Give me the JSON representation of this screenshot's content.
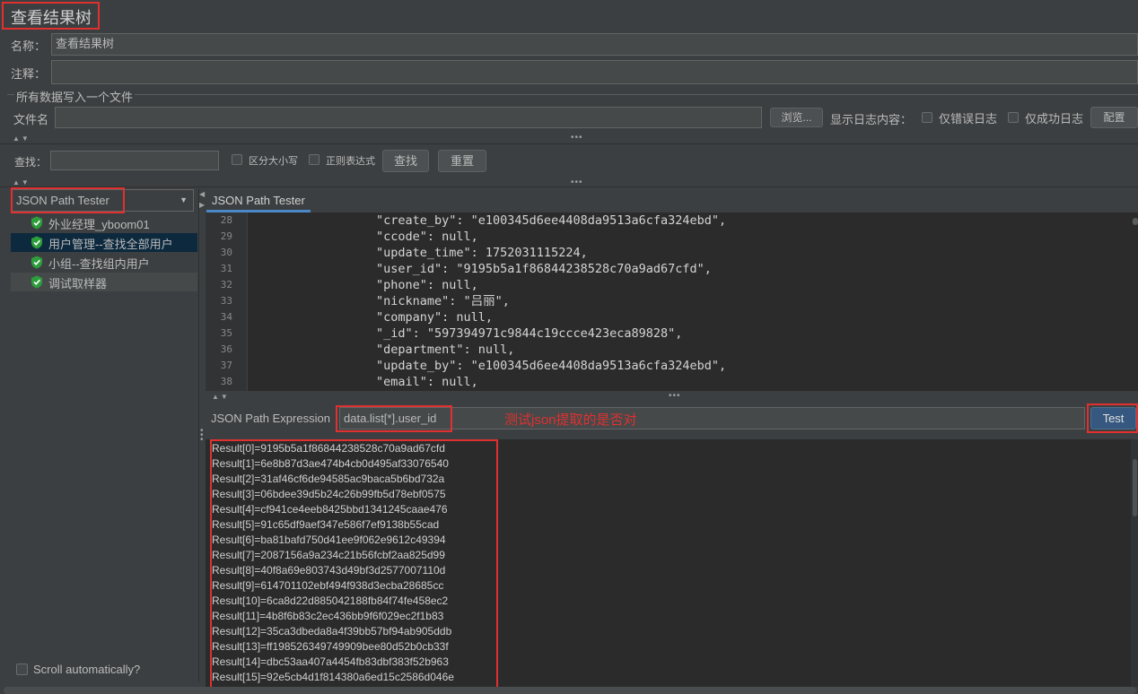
{
  "title": "查看结果树",
  "name_label": "名称：",
  "name_value": "查看结果树",
  "comment_label": "注释：",
  "comment_value": "",
  "group_title": "所有数据写入一个文件",
  "filename_label": "文件名",
  "filename_value": "",
  "browse_button": "浏览...",
  "log_content_label": "显示日志内容：",
  "errors_only_label": "仅错误日志",
  "success_only_label": "仅成功日志",
  "config_button": "配置",
  "search": {
    "label": "查找：",
    "value": "",
    "case_sensitive_label": "区分大小写",
    "regex_label": "正则表达式",
    "find_button": "查找",
    "reset_button": "重置"
  },
  "renderer_select": "JSON Path Tester",
  "tree_items": [
    {
      "label": "外业经理_yboom01",
      "status": "success"
    },
    {
      "label": "用户管理--查找全部用户",
      "status": "success"
    },
    {
      "label": "小组--查找组内用户",
      "status": "success"
    },
    {
      "label": "调试取样器",
      "status": "success"
    }
  ],
  "scroll_auto_label": "Scroll automatically?",
  "tab_label": "JSON Path Tester",
  "code_lines": [
    {
      "n": "28",
      "text": "\"create_by\": \"e100345d6ee4408da9513a6cfa324ebd\","
    },
    {
      "n": "29",
      "text": "\"ccode\": null,"
    },
    {
      "n": "30",
      "text": "\"update_time\": 1752031115224,"
    },
    {
      "n": "31",
      "text": "\"user_id\": \"9195b5a1f86844238528c70a9ad67cfd\","
    },
    {
      "n": "32",
      "text": "\"phone\": null,"
    },
    {
      "n": "33",
      "text": "\"nickname\": \"吕丽\","
    },
    {
      "n": "34",
      "text": "\"company\": null,"
    },
    {
      "n": "35",
      "text": "\"_id\": \"597394971c9844c19ccce423eca89828\","
    },
    {
      "n": "36",
      "text": "\"department\": null,"
    },
    {
      "n": "37",
      "text": "\"update_by\": \"e100345d6ee4408da9513a6cfa324ebd\","
    },
    {
      "n": "38",
      "text": "\"email\": null,"
    }
  ],
  "expression_label": "JSON Path Expression",
  "expression_value": "data.list[*].user_id",
  "annotation_text": "测试json提取的是否对",
  "test_button": "Test",
  "results": [
    "Result[0]=9195b5a1f86844238528c70a9ad67cfd",
    "Result[1]=6e8b87d3ae474b4cb0d495af33076540",
    "Result[2]=31af46cf6de94585ac9baca5b6bd732a",
    "Result[3]=06bdee39d5b24c26b99fb5d78ebf0575",
    "Result[4]=cf941ce4eeb8425bbd1341245caae476",
    "Result[5]=91c65df9aef347e586f7ef9138b55cad",
    "Result[6]=ba81bafd750d41ee9f062e9612c49394",
    "Result[7]=2087156a9a234c21b56fcbf2aa825d99",
    "Result[8]=40f8a69e803743d49bf3d2577007110d",
    "Result[9]=614701102ebf494f938d3ecba28685cc",
    "Result[10]=6ca8d22d885042188fb84f74fe458ec2",
    "Result[11]=4b8f6b83c2ec436bb9f6f029ec2f1b83",
    "Result[12]=35ca3dbeda8a4f39bb57bf94ab905ddb",
    "Result[13]=ff198526349749909bee80d52b0cb33f",
    "Result[14]=dbc53aa407a4454fb83dbf383f52b963",
    "Result[15]=92e5cb4d1f814380a6ed15c2586d046e"
  ],
  "colors": {
    "annotation_red": "#e0302f",
    "success_green": "#2e9d3c",
    "selection": "#0d293e"
  }
}
